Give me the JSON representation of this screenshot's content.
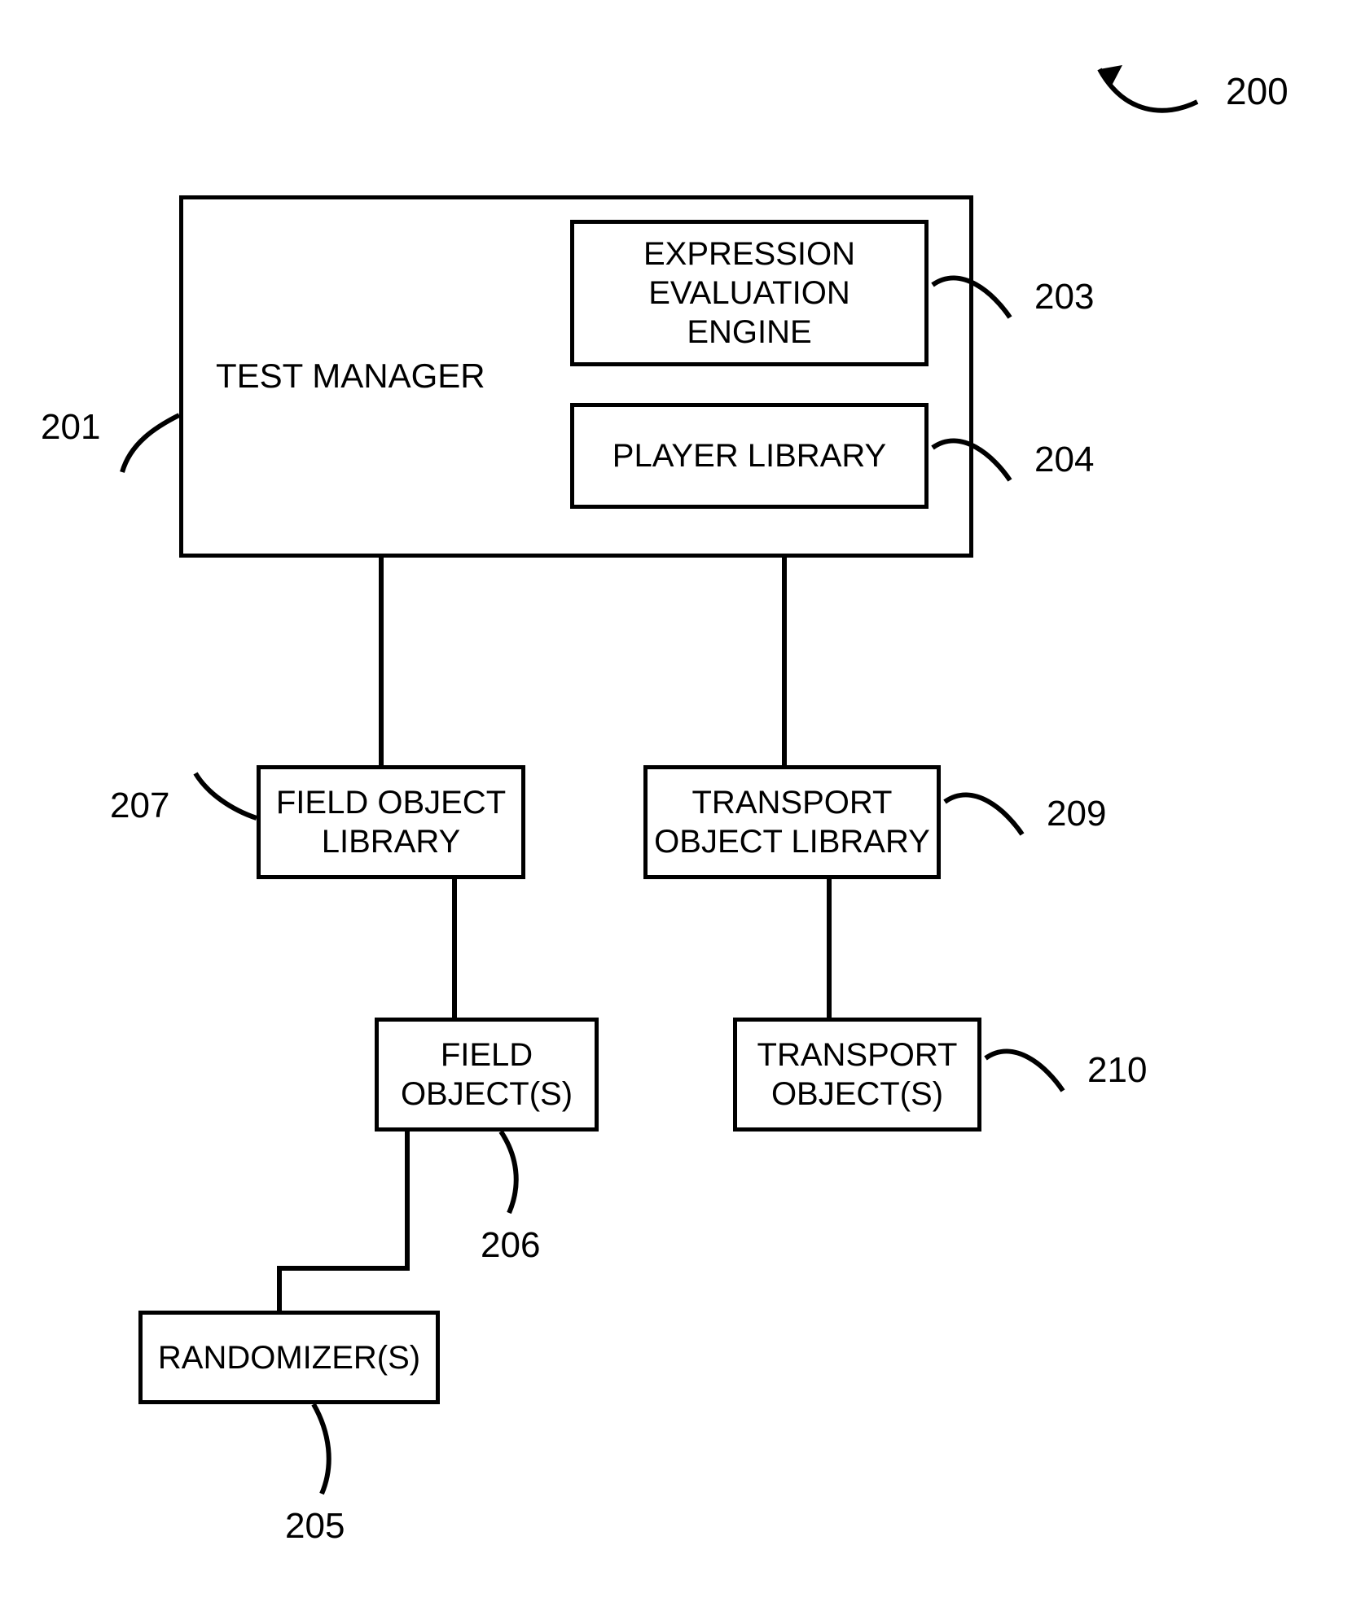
{
  "figure_ref": "200",
  "blocks": {
    "test_manager": {
      "label": "TEST MANAGER",
      "ref": "201"
    },
    "expr_engine": {
      "label": "EXPRESSION\nEVALUATION\nENGINE",
      "ref": "203"
    },
    "player_lib": {
      "label": "PLAYER LIBRARY",
      "ref": "204"
    },
    "field_obj_lib": {
      "label": "FIELD OBJECT\nLIBRARY",
      "ref": "207"
    },
    "transport_lib": {
      "label": "TRANSPORT\nOBJECT LIBRARY",
      "ref": "209"
    },
    "field_objs": {
      "label": "FIELD\nOBJECT(S)",
      "ref": "206"
    },
    "transport_objs": {
      "label": "TRANSPORT\nOBJECT(S)",
      "ref": "210"
    },
    "randomizers": {
      "label": "RANDOMIZER(S)",
      "ref": "205"
    }
  }
}
